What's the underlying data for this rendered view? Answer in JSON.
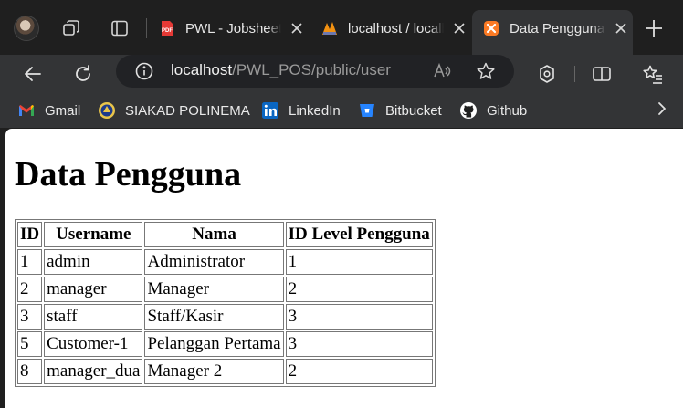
{
  "browser": {
    "tabs": [
      {
        "title": "PWL - Jobsheet",
        "favicon": "pdf-icon",
        "active": false
      },
      {
        "title": "localhost / localhost",
        "favicon": "phpmyadmin-icon",
        "active": false
      },
      {
        "title": "Data Pengguna",
        "favicon": "xampp-icon",
        "active": true
      }
    ],
    "address": {
      "host": "localhost",
      "path": "/PWL_POS/public/user"
    },
    "bookmarks": [
      {
        "label": "Gmail",
        "icon": "gmail-icon"
      },
      {
        "label": "SIAKAD POLINEMA",
        "icon": "polinema-icon"
      },
      {
        "label": "LinkedIn",
        "icon": "linkedin-icon"
      },
      {
        "label": "Bitbucket",
        "icon": "bitbucket-icon"
      },
      {
        "label": "Github",
        "icon": "github-icon"
      }
    ],
    "colors": {
      "chrome_dark": "#1f1f1f",
      "toolbar": "#333436",
      "omnibox": "#212225",
      "pdf_red": "#e53935",
      "xampp_orange": "#fb7a24",
      "linkedin_blue": "#0a66c2",
      "bitbucket_blue": "#2684ff"
    }
  },
  "page": {
    "heading": "Data Pengguna",
    "table": {
      "headers": [
        "ID",
        "Username",
        "Nama",
        "ID Level Pengguna"
      ],
      "rows": [
        [
          "1",
          "admin",
          "Administrator",
          "1"
        ],
        [
          "2",
          "manager",
          "Manager",
          "2"
        ],
        [
          "3",
          "staff",
          "Staff/Kasir",
          "3"
        ],
        [
          "5",
          "Customer-1",
          "Pelanggan Pertama",
          "3"
        ],
        [
          "8",
          "manager_dua",
          "Manager 2",
          "2"
        ]
      ]
    }
  }
}
